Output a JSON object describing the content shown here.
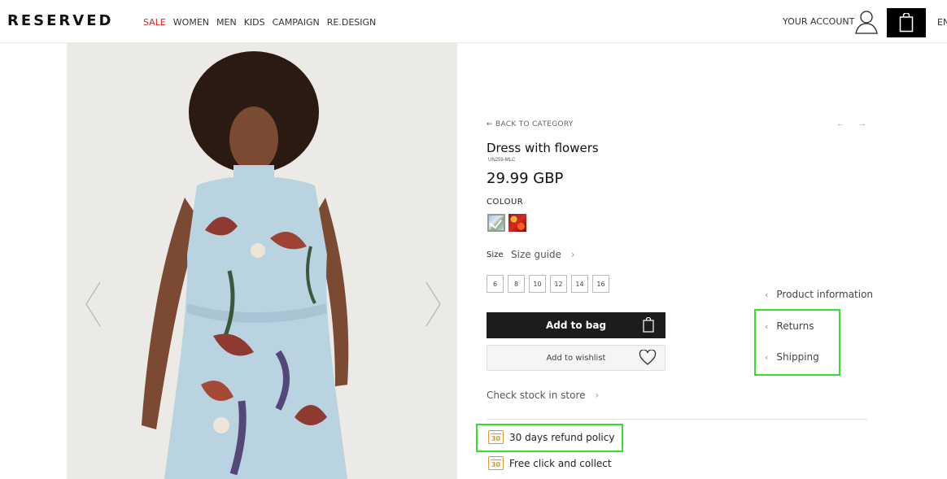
{
  "header": {
    "logo": "RESERVED",
    "nav": [
      "SALE",
      "WOMEN",
      "MEN",
      "KIDS",
      "CAMPAIGN",
      "RE.DESIGN"
    ],
    "account": "YOUR ACCOUNT",
    "lang": "EN"
  },
  "product": {
    "back": "← BACK TO CATEGORY",
    "pager": "← →",
    "title": "Dress with flowers",
    "sku": "UN259-MLC",
    "price": "29.99 GBP",
    "colour_label": "COLOUR",
    "size_label": "Size",
    "size_guide": "Size guide",
    "sizes": [
      "6",
      "8",
      "10",
      "12",
      "14",
      "16"
    ],
    "add_to_bag": "Add to bag",
    "add_to_wishlist": "Add to wishlist",
    "check_stock": "Check stock in store",
    "perks": [
      {
        "icon": "calendar-icon",
        "badge": "30",
        "text": "30 days refund policy"
      },
      {
        "icon": "calendar-icon",
        "badge": "30",
        "text": "Free click and collect"
      }
    ],
    "info_links": [
      "Product information",
      "Returns",
      "Shipping"
    ]
  },
  "colors": {
    "sale": "#d62828",
    "accent_orange": "#e0962a",
    "highlight": "#32e02c",
    "button_dark": "#1c1c1c"
  }
}
